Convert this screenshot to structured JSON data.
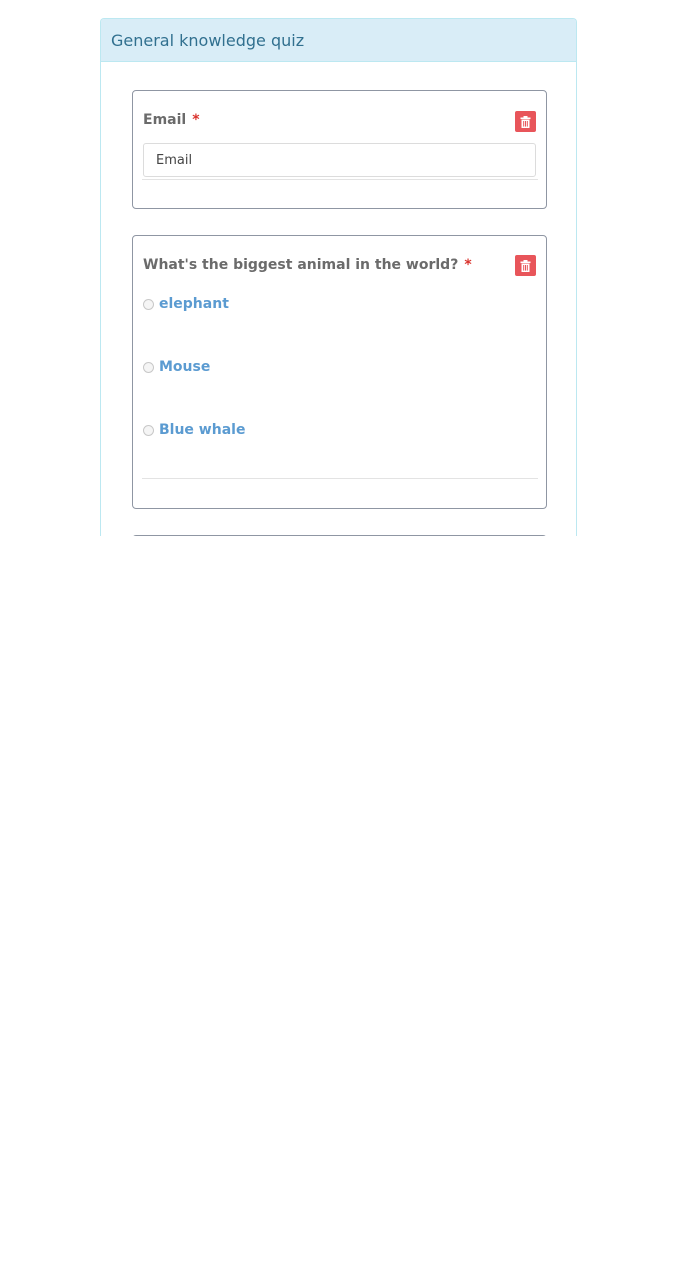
{
  "quiz": {
    "title": "General knowledge quiz"
  },
  "questions": [
    {
      "label": "Email",
      "required_marker": "*",
      "input_placeholder": "Email",
      "delete_icon": "trash-icon"
    },
    {
      "label": "What's the biggest animal in the world?",
      "required_marker": "*",
      "delete_icon": "trash-icon",
      "options": [
        {
          "label": "elephant",
          "selected": false
        },
        {
          "label": "Mouse",
          "selected": false
        },
        {
          "label": "Blue whale",
          "selected": false
        }
      ]
    }
  ],
  "colors": {
    "panel_heading_bg": "#d9edf7",
    "panel_heading_text": "#31708f",
    "delete_button": "#e8555a",
    "option_text": "#5b9bd1",
    "required_marker": "#d9312b"
  }
}
